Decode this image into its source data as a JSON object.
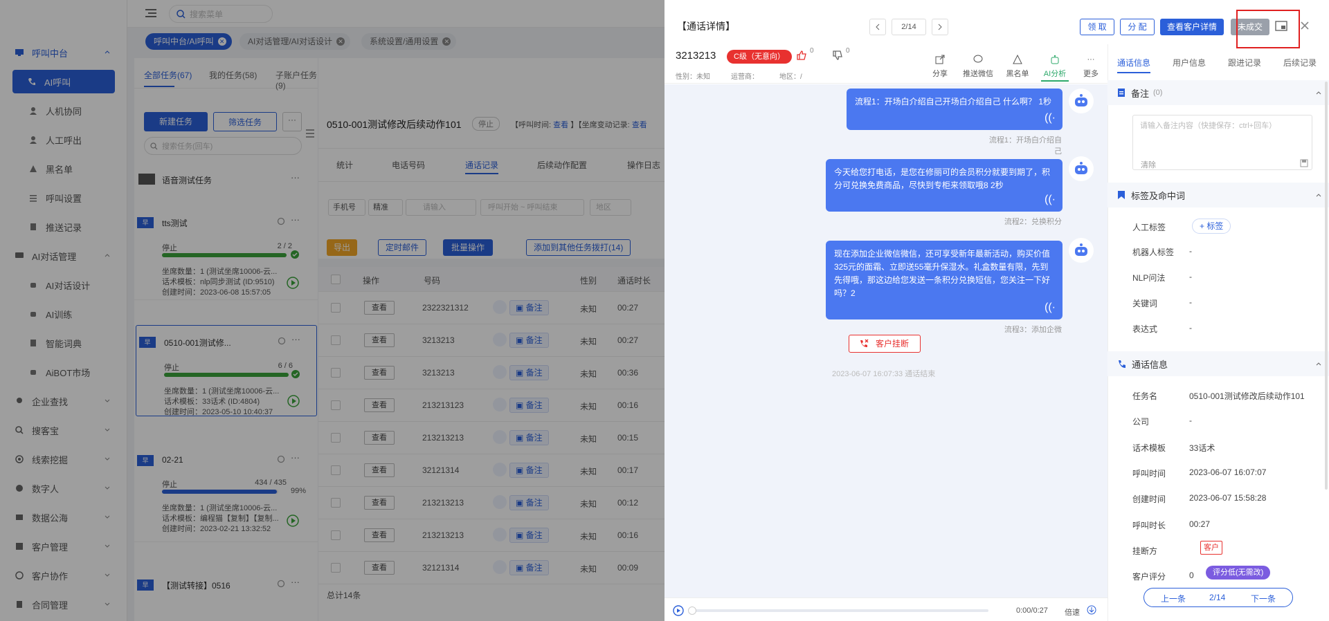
{
  "sidebar": {
    "items": [
      {
        "label": "呼叫中台",
        "icon": "monitor-icon",
        "group": true,
        "active_group": true
      },
      {
        "label": "AI呼叫",
        "icon": "phone-icon",
        "active": true
      },
      {
        "label": "人机协同",
        "icon": "user-icon"
      },
      {
        "label": "人工呼出",
        "icon": "user-icon"
      },
      {
        "label": "黑名单",
        "icon": "warning-icon"
      },
      {
        "label": "呼叫设置",
        "icon": "settings-icon"
      },
      {
        "label": "推送记录",
        "icon": "doc-icon"
      },
      {
        "label": "AI对话管理",
        "icon": "chat-icon",
        "group": true
      },
      {
        "label": "AI对话设计",
        "icon": "robot-icon"
      },
      {
        "label": "AI训练",
        "icon": "robot-icon"
      },
      {
        "label": "智能词典",
        "icon": "book-icon"
      },
      {
        "label": "AiBOT市场",
        "icon": "robot-icon"
      },
      {
        "label": "企业查找",
        "icon": "bulb-icon",
        "group": true
      },
      {
        "label": "搜客宝",
        "icon": "search-icon",
        "group": true
      },
      {
        "label": "线索挖掘",
        "icon": "target-icon",
        "group": true
      },
      {
        "label": "数字人",
        "icon": "person-icon",
        "group": true
      },
      {
        "label": "数据公海",
        "icon": "data-icon",
        "group": true
      },
      {
        "label": "客户管理",
        "icon": "customer-icon",
        "group": true
      },
      {
        "label": "客户协作",
        "icon": "handshake-icon",
        "group": true
      },
      {
        "label": "合同管理",
        "icon": "contract-icon",
        "group": true
      }
    ]
  },
  "topbar": {
    "search_placeholder": "搜索菜单"
  },
  "page_tabs": [
    {
      "label": "呼叫中台/AI呼叫",
      "active": true
    },
    {
      "label": "AI对话管理/AI对话设计",
      "active": false
    },
    {
      "label": "系统设置/通用设置",
      "active": false
    }
  ],
  "task_panel": {
    "subtabs": [
      "全部任务(67)",
      "我的任务(58)",
      "子账户任务(9)"
    ],
    "new_task": "新建任务",
    "filter_task": "筛选任务",
    "more": "···",
    "search_placeholder": "搜索任务(回车)",
    "group_title": "语音测试任务",
    "tasks": [
      {
        "flag": "早",
        "name": "tts测试",
        "status": "停止",
        "progress_text": "2 / 2",
        "progress": 1.0,
        "color": "#3aa33a",
        "seats": "坐席数量：1 (测试坐席10006-云...",
        "script": "话术模板：nlp同步测试 (ID:9510)",
        "created": "创建时间：2023-06-08 15:57:05"
      },
      {
        "flag": "早",
        "name": "0510-001测试修...",
        "status": "停止",
        "progress_text": "6 / 6",
        "progress": 1.0,
        "color": "#3aa33a",
        "seats": "坐席数量：1 (测试坐席10006-云...",
        "script": "话术模板：33话术 (ID:4804)",
        "created": "创建时间：2023-05-10 10:40:37"
      },
      {
        "flag": "早",
        "name": "02-21",
        "status": "停止",
        "progress_text": "434 / 435",
        "progress": 0.99,
        "pct": "99%",
        "color": "#2b5fd9",
        "seats": "坐席数量：1 (测试坐席10006-云...",
        "script": "话术模板：编程猫【复制】【复制...",
        "created": "创建时间：2023-02-21 13:32:52"
      },
      {
        "flag": "早",
        "name": "【测试转接】0516"
      }
    ]
  },
  "main": {
    "task_title": "0510-001测试修改后续动作101",
    "status": "停止",
    "call_time": "【呼叫时间:",
    "view1": "查看",
    "seat_log": "】【坐席变动记录:",
    "view2": "查看",
    "tabs": [
      "统计",
      "电话号码",
      "通话记录",
      "后续动作配置",
      "操作日志"
    ],
    "filters": {
      "phone": "手机号",
      "exact": "精准",
      "input_placeholder": "请输入",
      "time_range": "呼叫开始 ~ 呼叫结束",
      "region": "地区"
    },
    "actions": {
      "export": "导出",
      "mail": "定时邮件",
      "batch": "批量操作",
      "add_task": "添加到其他任务拨打(14)"
    },
    "columns": [
      "操作",
      "号码",
      "性别",
      "通话时长"
    ],
    "rows": [
      {
        "num": "2322321312",
        "gender": "未知",
        "duration": "00:27"
      },
      {
        "num": "3213213",
        "gender": "未知",
        "duration": "00:27"
      },
      {
        "num": "3213213",
        "gender": "未知",
        "duration": "00:36"
      },
      {
        "num": "213213123",
        "gender": "未知",
        "duration": "00:16"
      },
      {
        "num": "213213213",
        "gender": "未知",
        "duration": "00:15"
      },
      {
        "num": "32121314",
        "gender": "未知",
        "duration": "00:17"
      },
      {
        "num": "213213213",
        "gender": "未知",
        "duration": "00:12"
      },
      {
        "num": "213213213",
        "gender": "未知",
        "duration": "00:16"
      },
      {
        "num": "32121314",
        "gender": "未知",
        "duration": "00:09"
      }
    ],
    "view_label": "查看",
    "note_label": "备注",
    "total": "总计14条"
  },
  "drawer": {
    "title": "【通话详情】",
    "pager": "2/14",
    "btn_claim": "领 取",
    "btn_assign": "分 配",
    "btn_detail": "查看客户详情",
    "btn_unclosed": "未成交",
    "phone": "3213213",
    "level": "C级（无意向）",
    "likes": "0",
    "dislikes": "0",
    "gender": "性别：未知",
    "carrier": "运营商：",
    "region": "地区：/",
    "tools": [
      "分享",
      "推送微信",
      "黑名单",
      "AI分析",
      "更多"
    ],
    "messages": [
      {
        "text": "流程1：开场白介绍自己开场白介绍自己 什么啊？ 1秒",
        "flow": "流程1：开场白介绍自己"
      },
      {
        "text": "今天给您打电话，是您在修丽可的会员积分就要到期了，积分可兑换免费商品，尽快到专柜来领取哦8 2秒",
        "flow": "流程2：兑换积分"
      },
      {
        "text": "现在添加企业微信微信，还可享受新年最新活动，购买价值325元的面霜、立即送55毫升保湿水。礼盒数量有限，先到先得哦，那这边给您发送一条积分兑换短信，您关注一下好吗？2",
        "flow": "流程3：添加企微"
      }
    ],
    "hangup": "客户挂断",
    "call_end": "2023-06-07 16:07:33 通话结束",
    "audio_time": "0:00/0:27",
    "speed": "倍速",
    "right_tabs": [
      "通话信息",
      "用户信息",
      "跟进记录",
      "后续记录"
    ],
    "notes_title": "备注",
    "notes_count": "(0)",
    "notes_placeholder": "请输入备注内容（快捷保存：ctrl+回车）",
    "clear": "清除",
    "tags_title": "标签及命中词",
    "tags": [
      {
        "label": "人工标签",
        "value": "+ 标签"
      },
      {
        "label": "机器人标签",
        "value": "-"
      },
      {
        "label": "NLP问法",
        "value": "-"
      },
      {
        "label": "关键词",
        "value": "-"
      },
      {
        "label": "表达式",
        "value": "-"
      }
    ],
    "callinfo_title": "通话信息",
    "callinfo": [
      {
        "label": "任务名",
        "value": "0510-001测试修改后续动作101"
      },
      {
        "label": "公司",
        "value": "-"
      },
      {
        "label": "话术模板",
        "value": "33话术"
      },
      {
        "label": "呼叫时间",
        "value": "2023-06-07 16:07:07"
      },
      {
        "label": "创建时间",
        "value": "2023-06-07 15:58:28"
      },
      {
        "label": "呼叫时长",
        "value": "00:27"
      },
      {
        "label": "挂断方",
        "value": "客户"
      },
      {
        "label": "客户评分",
        "value": "0"
      }
    ],
    "score_badge": "评分低(无需改)",
    "prev": "上一条",
    "next": "下一条",
    "pager2": "2/14",
    "colors": {
      "accent": "#2b5fd9",
      "danger": "#e8312f",
      "bubble": "#4b78f0",
      "highlight_box": "#e02020"
    }
  }
}
